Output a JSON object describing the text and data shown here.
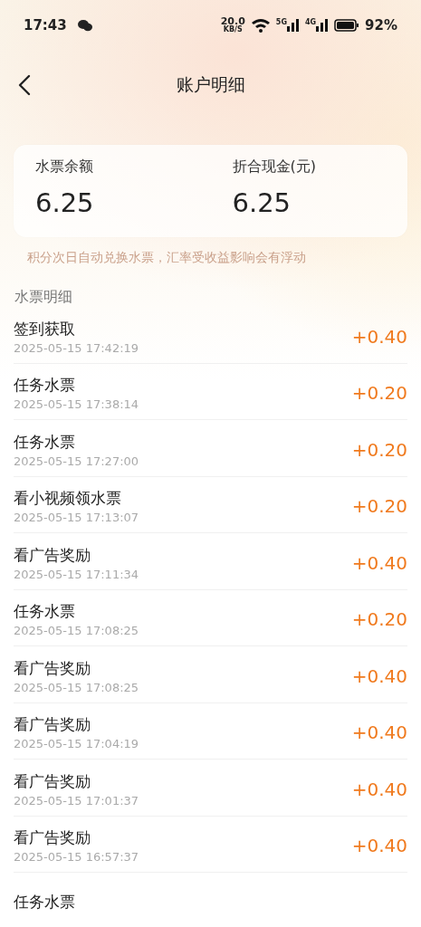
{
  "status_bar": {
    "time": "17:43",
    "speed": "20.0",
    "speed_unit": "KB/S",
    "network_1": "5G",
    "network_2": "4G",
    "battery": "92%"
  },
  "header": {
    "title": "账户明细"
  },
  "balance_card": {
    "items": [
      {
        "label": "水票余额",
        "value": "6.25"
      },
      {
        "label": "折合现金(元)",
        "value": "6.25"
      }
    ]
  },
  "note": "积分次日自动兑换水票，汇率受收益影响会有浮动",
  "section_title": "水票明细",
  "records": [
    {
      "title": "签到获取",
      "time": "2025-05-15 17:42:19",
      "amount": "+0.40"
    },
    {
      "title": "任务水票",
      "time": "2025-05-15 17:38:14",
      "amount": "+0.20"
    },
    {
      "title": "任务水票",
      "time": "2025-05-15 17:27:00",
      "amount": "+0.20"
    },
    {
      "title": "看小视频领水票",
      "time": "2025-05-15 17:13:07",
      "amount": "+0.20"
    },
    {
      "title": "看广告奖励",
      "time": "2025-05-15 17:11:34",
      "amount": "+0.40"
    },
    {
      "title": "任务水票",
      "time": "2025-05-15 17:08:25",
      "amount": "+0.20"
    },
    {
      "title": "看广告奖励",
      "time": "2025-05-15 17:08:25",
      "amount": "+0.40"
    },
    {
      "title": "看广告奖励",
      "time": "2025-05-15 17:04:19",
      "amount": "+0.40"
    },
    {
      "title": "看广告奖励",
      "time": "2025-05-15 17:01:37",
      "amount": "+0.40"
    },
    {
      "title": "看广告奖励",
      "time": "2025-05-15 16:57:37",
      "amount": "+0.40"
    },
    {
      "title": "任务水票"
    }
  ]
}
